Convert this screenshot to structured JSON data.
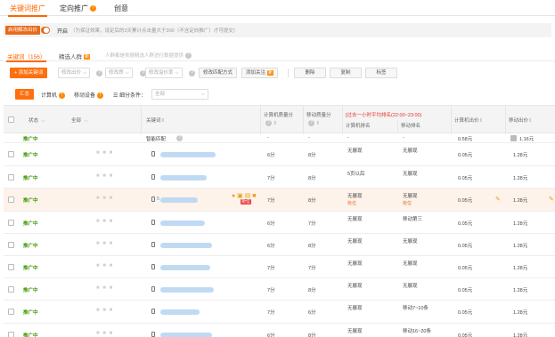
{
  "top_tabs": [
    {
      "label": "关键词推广"
    },
    {
      "label": "定向推广"
    },
    {
      "label": "创意"
    }
  ],
  "notice": {
    "button": "启用解冻出价",
    "state": "开启",
    "text": "（为保证效果，设定后的3天累计点击量大于300（不含定向推广）才可提交）"
  },
  "sub_tabs": [
    {
      "label": "关键词（156）"
    },
    {
      "label": "精选人群",
      "badge": "新"
    }
  ],
  "sub_hint": "人群都是依据精选人群进行数据提供",
  "toolbar": {
    "add_keyword": "+ 添加关键词",
    "bid_select": "修改出价",
    "quality_select": "修改质",
    "bid_adjust_select": "修改溢价率",
    "match_btn": "修改匹配方式",
    "follow_btn": "添加关注",
    "follow_badge": "新",
    "delete_btn": "删除",
    "copy_btn": "复制",
    "tag_btn": "标签"
  },
  "toolbar2": {
    "summary_btn": "汇总",
    "computer": "计算机",
    "mobile": "移动设备",
    "filter_label": "细分条件：",
    "filter_value": "全部"
  },
  "table": {
    "headers": {
      "status": "状态",
      "all": "全部",
      "keyword": "关键词",
      "pc_quality": "计算机质量分",
      "mobile_quality": "移动质量分",
      "rank_title": "[过去一小时平均排名(22:00~23:00)",
      "pc_rank": "计算机排名",
      "mobile_rank": "移动排名",
      "pc_bid": "计算机出价",
      "mobile_bid": "移动出价"
    },
    "rows": [
      {
        "status": "推广中",
        "keyword": "智能匹配",
        "pc_quality": "-",
        "mobile_quality": "-",
        "pc_rank": "-",
        "mobile_rank": "-",
        "pc_bid": "0.58元",
        "mobile_bid": "1.16元",
        "pc_rank_sub": "",
        "mobile_rank_sub": ""
      },
      {
        "status": "推广中",
        "keyword": "",
        "pc_quality": "6分",
        "mobile_quality": "8分",
        "pc_rank": "无展现",
        "mobile_rank": "无展现",
        "pc_bid": "0.05元",
        "mobile_bid": "1.28元",
        "pc_rank_sub": "",
        "mobile_rank_sub": ""
      },
      {
        "status": "推广中",
        "keyword": "",
        "pc_quality": "7分",
        "mobile_quality": "8分",
        "pc_rank": "5页以后",
        "mobile_rank": "无展现",
        "pc_bid": "0.05元",
        "mobile_bid": "1.28元",
        "pc_rank_sub": "",
        "mobile_rank_sub": ""
      },
      {
        "status": "推广中",
        "keyword": "5",
        "pc_quality": "7分",
        "mobile_quality": "8分",
        "pc_rank": "无展现",
        "mobile_rank": "无展现",
        "pc_bid": "0.05元",
        "mobile_bid": "1.28元",
        "pc_rank_sub": "抢位",
        "mobile_rank_sub": "抢位",
        "tag": "抢位"
      },
      {
        "status": "推广中",
        "keyword": "",
        "pc_quality": "6分",
        "mobile_quality": "7分",
        "pc_rank": "无展现",
        "mobile_rank": "移动第三",
        "pc_bid": "0.05元",
        "mobile_bid": "1.28元",
        "pc_rank_sub": "",
        "mobile_rank_sub": ""
      },
      {
        "status": "推广中",
        "keyword": "",
        "pc_quality": "6分",
        "mobile_quality": "8分",
        "pc_rank": "无展现",
        "mobile_rank": "无展现",
        "pc_bid": "0.05元",
        "mobile_bid": "1.28元",
        "pc_rank_sub": "",
        "mobile_rank_sub": ""
      },
      {
        "status": "推广中",
        "keyword": "",
        "pc_quality": "7分",
        "mobile_quality": "7分",
        "pc_rank": "无展现",
        "mobile_rank": "无展现",
        "pc_bid": "0.05元",
        "mobile_bid": "1.28元",
        "pc_rank_sub": "",
        "mobile_rank_sub": ""
      },
      {
        "status": "推广中",
        "keyword": "",
        "pc_quality": "7分",
        "mobile_quality": "8分",
        "pc_rank": "无展现",
        "mobile_rank": "无展现",
        "pc_bid": "0.05元",
        "mobile_bid": "1.28元",
        "pc_rank_sub": "",
        "mobile_rank_sub": ""
      },
      {
        "status": "推广中",
        "keyword": "",
        "pc_quality": "7分",
        "mobile_quality": "6分",
        "pc_rank": "无展现",
        "mobile_rank": "移动7~10条",
        "pc_bid": "0.05元",
        "mobile_bid": "1.28元",
        "pc_rank_sub": "",
        "mobile_rank_sub": ""
      },
      {
        "status": "推广中",
        "keyword": "",
        "pc_quality": "6分",
        "mobile_quality": "8分",
        "pc_rank": "无展现",
        "mobile_rank": "移动16~20条",
        "pc_bid": "0.05元",
        "mobile_bid": "1.28元",
        "pc_rank_sub": "",
        "mobile_rank_sub": ""
      }
    ]
  },
  "colors": {
    "accent": "#ff6600",
    "status_green": "#3c9a00",
    "highlight_row": "#fdf3ea"
  }
}
